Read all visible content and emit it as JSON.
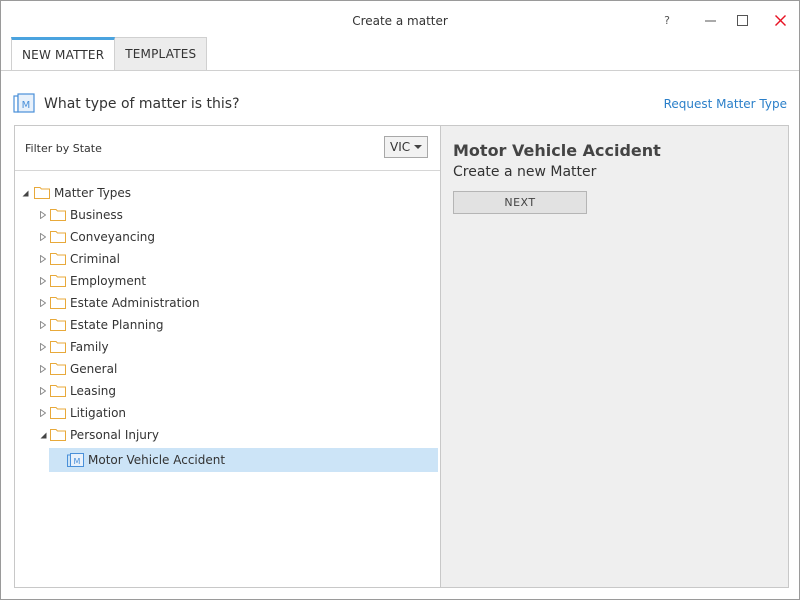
{
  "window": {
    "title": "Create a matter",
    "help_label": "?",
    "minimize_label": "—",
    "maximize_label": "☐",
    "close_label": "✕"
  },
  "tabs": [
    {
      "label": "NEW MATTER",
      "active": true
    },
    {
      "label": "TEMPLATES",
      "active": false
    }
  ],
  "header": {
    "question": "What type of matter is this?",
    "request_link": "Request Matter Type"
  },
  "filter": {
    "label": "Filter by State",
    "selected_state": "VIC"
  },
  "tree": {
    "root": {
      "label": "Matter Types",
      "expanded": true
    },
    "items": [
      {
        "label": "Business",
        "expanded": false
      },
      {
        "label": "Conveyancing",
        "expanded": false
      },
      {
        "label": "Criminal",
        "expanded": false
      },
      {
        "label": "Employment",
        "expanded": false
      },
      {
        "label": "Estate Administration",
        "expanded": false
      },
      {
        "label": "Estate Planning",
        "expanded": false
      },
      {
        "label": "Family",
        "expanded": false
      },
      {
        "label": "General",
        "expanded": false
      },
      {
        "label": "Leasing",
        "expanded": false
      },
      {
        "label": "Litigation",
        "expanded": false
      },
      {
        "label": "Personal Injury",
        "expanded": true
      }
    ],
    "selected_child": {
      "label": "Motor Vehicle Accident"
    }
  },
  "detail": {
    "title": "Motor Vehicle Accident",
    "subtitle": "Create a new Matter",
    "next_label": "NEXT"
  },
  "colors": {
    "accent": "#4aa3df",
    "link": "#2a7fc9",
    "folder": "#e8a93a",
    "selected_row": "#cce4f7",
    "close": "#e81123"
  }
}
